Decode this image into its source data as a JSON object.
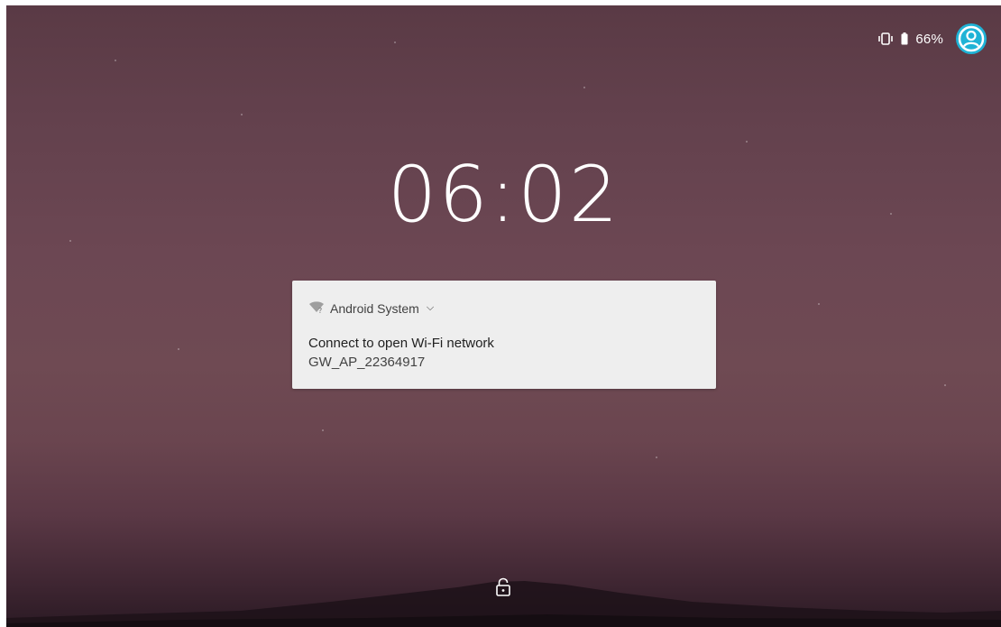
{
  "status_bar": {
    "vibrate_icon": "vibrate-icon",
    "battery_icon": "battery-icon",
    "battery_percent": "66%",
    "avatar_icon": "user-avatar-icon",
    "avatar_color": "#1fb3d6"
  },
  "clock": {
    "time": "06:02"
  },
  "notification": {
    "icon": "wifi-question-icon",
    "app_name": "Android System",
    "expand_icon": "chevron-down-icon",
    "title": "Connect to open Wi-Fi network",
    "text": "GW_AP_22364917"
  },
  "lock": {
    "icon": "unlock-icon"
  }
}
